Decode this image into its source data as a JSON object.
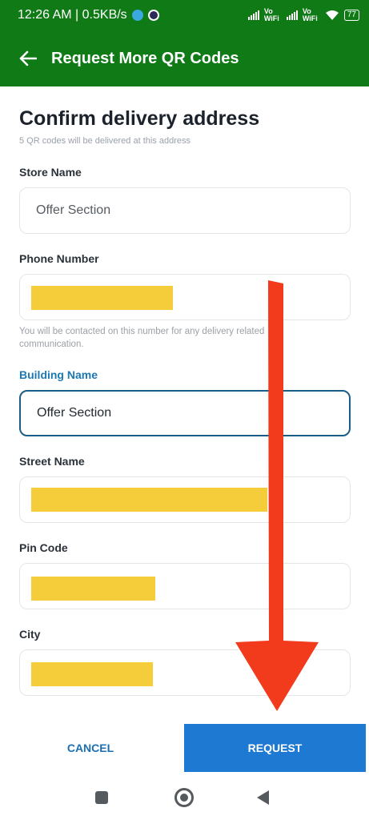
{
  "status_bar": {
    "time_speed": "12:26 AM | 0.5KB/s",
    "vowifi_1": "Vo WiFi",
    "vowifi_2": "Vo WiFi",
    "battery": "77",
    "icons": [
      "telegram-icon",
      "privacy-icon",
      "signal-icon",
      "wifi-icon",
      "battery-icon"
    ]
  },
  "app_bar": {
    "title": "Request More QR Codes",
    "back_icon": "back-arrow-icon"
  },
  "form": {
    "title": "Confirm delivery address",
    "subtitle": "5 QR codes will be delivered at this address",
    "store_name": {
      "label": "Store Name",
      "value": "Offer Section"
    },
    "phone_number": {
      "label": "Phone Number",
      "value": "",
      "helper": "You will  be contacted on this number for any delivery related communication."
    },
    "building_name": {
      "label": "Building Name",
      "value": "Offer Section"
    },
    "street_name": {
      "label": "Street Name",
      "value": ""
    },
    "pin_code": {
      "label": "Pin Code",
      "value": ""
    },
    "city": {
      "label": "City",
      "value": ""
    }
  },
  "actions": {
    "cancel_label": "CANCEL",
    "request_label": "REQUEST"
  },
  "colors": {
    "header": "#0f7a16",
    "accent": "#1e79d2",
    "focused_label": "#1c78b5",
    "arrow": "#f23a1c",
    "redaction": "#f5cd3a"
  }
}
